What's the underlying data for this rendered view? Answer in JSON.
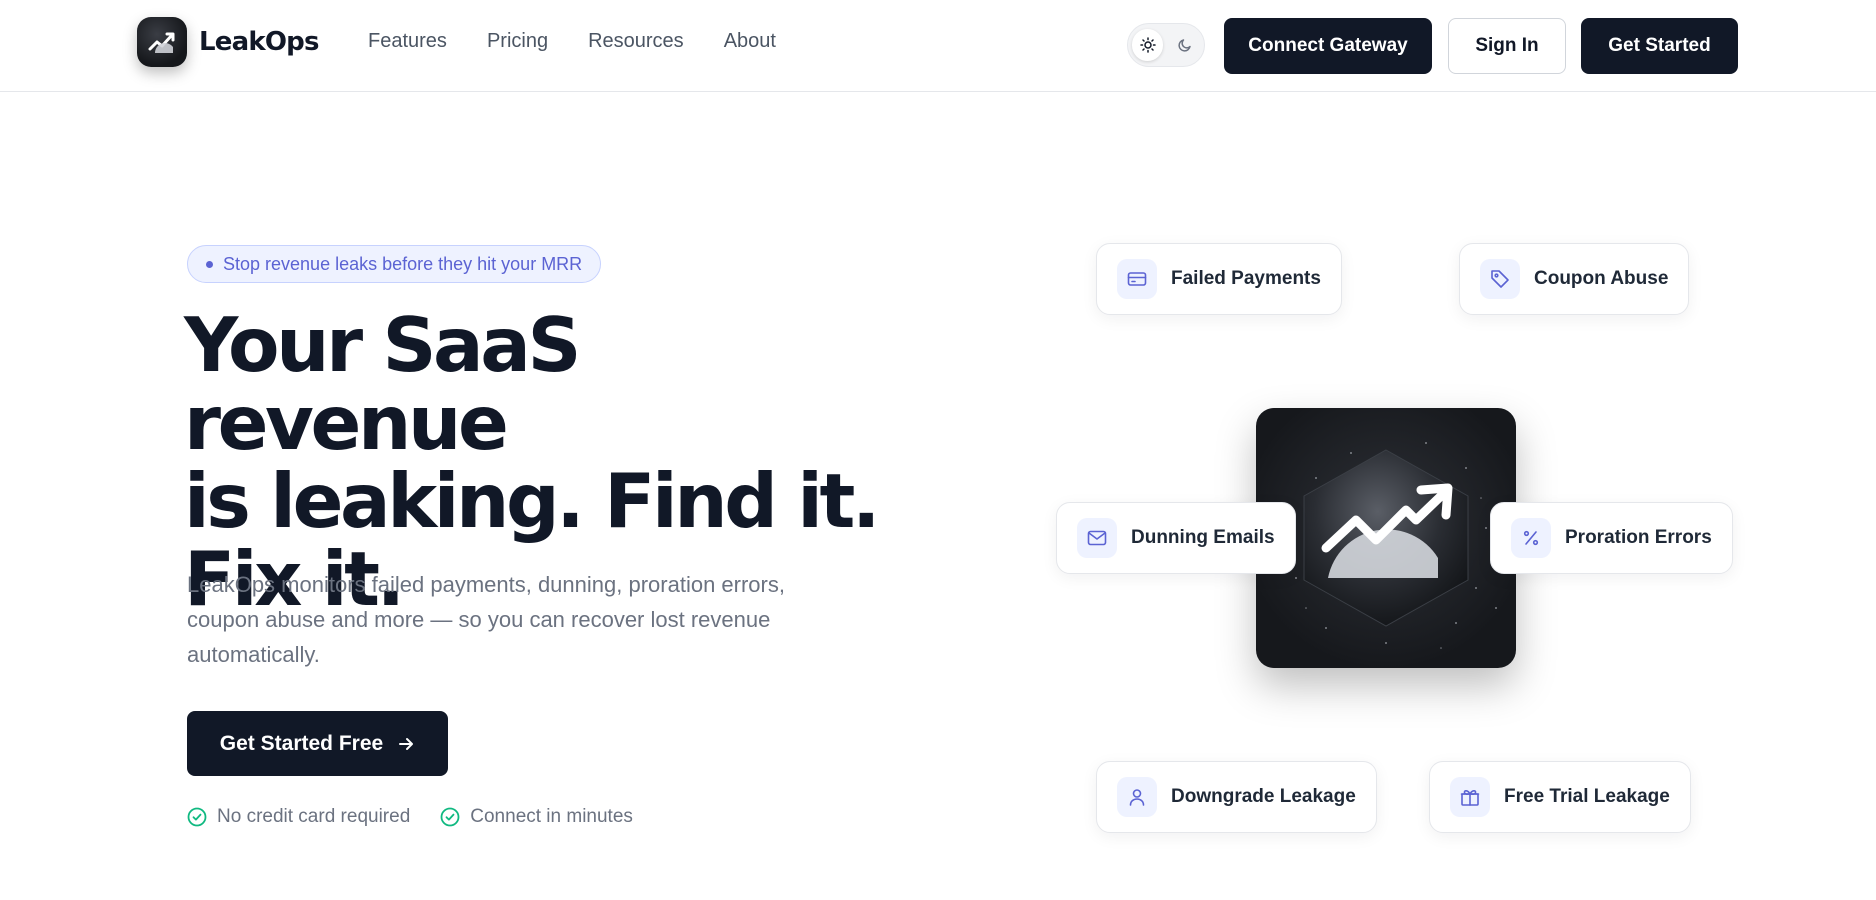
{
  "header": {
    "logo_text": "LeakOps",
    "nav": [
      "Features",
      "Pricing",
      "Resources",
      "About"
    ],
    "theme_toggle": {
      "options": [
        "sun-icon",
        "moon-icon"
      ],
      "active": "sun-icon"
    },
    "connect_gateway_label": "Connect Gateway",
    "sign_in_label": "Sign In",
    "get_started_label": "Get Started"
  },
  "hero": {
    "badge": "Stop revenue leaks before they hit your MRR",
    "headline_lines": [
      "Your SaaS revenue",
      "is leaking. Find it.",
      "Fix it."
    ],
    "subtext": "LeakOps monitors failed payments, dunning, proration errors, coupon abuse and more — so you can recover lost revenue automatically.",
    "cta_label": "Get Started Free",
    "checks": [
      "No credit card required",
      "Connect in minutes"
    ]
  },
  "features": [
    {
      "label": "Failed Payments",
      "icon": "credit-card-icon"
    },
    {
      "label": "Coupon Abuse",
      "icon": "tag-icon"
    },
    {
      "label": "Dunning Emails",
      "icon": "mail-icon"
    },
    {
      "label": "Proration Errors",
      "icon": "percent-icon"
    },
    {
      "label": "Downgrade Leakage",
      "icon": "user-icon"
    },
    {
      "label": "Free Trial Leakage",
      "icon": "gift-icon"
    }
  ],
  "colors": {
    "primary_dark": "#111827",
    "accent_indigo": "#5b63d3",
    "success_green": "#10b981",
    "muted_text": "#6b7280"
  }
}
